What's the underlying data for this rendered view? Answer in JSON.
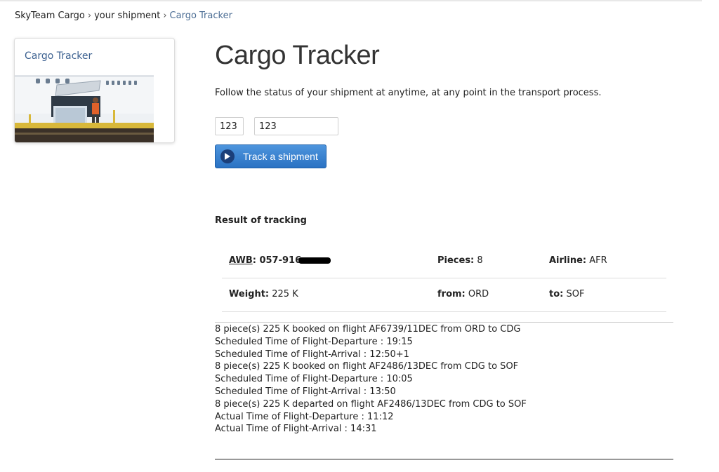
{
  "breadcrumb": {
    "items": [
      "SkyTeam Cargo",
      "your shipment"
    ],
    "current": "Cargo Tracker",
    "separator": "›"
  },
  "sidebar": {
    "card_title": "Cargo Tracker"
  },
  "main": {
    "title": "Cargo Tracker",
    "intro": "Follow the status of your shipment at anytime, at any point in the transport process.",
    "awb_prefix_value": "123",
    "awb_number_value": "123",
    "track_button_label": "Track a shipment"
  },
  "result": {
    "heading": "Result of tracking",
    "awb_label": "AWB",
    "awb_value": "057-916",
    "pieces_label": "Pieces:",
    "pieces_value": "8",
    "airline_label": "Airline:",
    "airline_value": "AFR",
    "weight_label": "Weight:",
    "weight_value": "225 K",
    "from_label": "from:",
    "from_value": "ORD",
    "to_label": "to:",
    "to_value": "SOF",
    "events": [
      "8 piece(s) 225 K booked on flight AF6739/11DEC from ORD to CDG",
      "Scheduled Time of Flight-Departure : 19:15",
      "Scheduled Time of Flight-Arrival : 12:50+1",
      "8 piece(s) 225 K booked on flight AF2486/13DEC from CDG to SOF",
      "Scheduled Time of Flight-Departure : 10:05",
      "Scheduled Time of Flight-Arrival : 13:50",
      "8 piece(s) 225 K departed on flight AF2486/13DEC from CDG to SOF",
      "Actual Time of Flight-Departure : 11:12",
      "Actual Time of Flight-Arrival : 14:31"
    ]
  },
  "colors": {
    "link": "#4a6c93",
    "button": "#2a72c3",
    "button_icon": "#1b3f7a"
  },
  "icons": {
    "button_icon": "play-circle-icon"
  }
}
